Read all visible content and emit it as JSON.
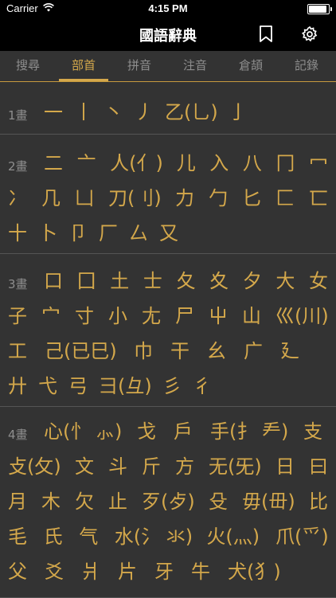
{
  "status_bar": {
    "carrier": "Carrier",
    "time": "4:15 PM"
  },
  "nav": {
    "title": "國語辭典"
  },
  "tabs": [
    {
      "label": "搜尋"
    },
    {
      "label": "部首"
    },
    {
      "label": "拼音"
    },
    {
      "label": "注音"
    },
    {
      "label": "倉頡"
    },
    {
      "label": "記錄"
    }
  ],
  "active_tab": "部首",
  "sections": [
    {
      "label": "1畫",
      "rows": [
        [
          "一",
          "丨",
          "丶",
          "丿",
          "乙(乚)",
          "亅"
        ]
      ]
    },
    {
      "label": "2畫",
      "rows": [
        [
          "二",
          "亠",
          "人(亻)",
          "儿",
          "入",
          "八",
          "冂",
          "冖"
        ],
        [
          "冫",
          "几",
          "凵",
          "刀(刂)",
          "力",
          "勹",
          "匕",
          "匚",
          "匸"
        ],
        [
          "十",
          "卜",
          "卩",
          "厂",
          "厶",
          "又"
        ]
      ]
    },
    {
      "label": "3畫",
      "rows": [
        [
          "口",
          "囗",
          "土",
          "士",
          "夂",
          "夊",
          "夕",
          "大",
          "女"
        ],
        [
          "子",
          "宀",
          "寸",
          "小",
          "尢",
          "尸",
          "屮",
          "山",
          "巛(川)"
        ],
        [
          "工",
          "己(已巳)",
          "巾",
          "干",
          "幺",
          "广",
          "廴"
        ],
        [
          "廾",
          "弋",
          "弓",
          "彐(彑)",
          "彡",
          "彳"
        ]
      ]
    },
    {
      "label": "4畫",
      "rows": [
        [
          "心(忄 ⺗)",
          "戈",
          "戶",
          "手(扌 龵)",
          "支"
        ],
        [
          "攴(攵)",
          "文",
          "斗",
          "斤",
          "方",
          "无(旡)",
          "日",
          "曰"
        ],
        [
          "月",
          "木",
          "欠",
          "止",
          "歹(歺)",
          "殳",
          "毋(毌)",
          "比"
        ],
        [
          "毛",
          "氏",
          "气",
          "水(氵 氺)",
          "火(灬)",
          "爪(爫)"
        ],
        [
          "父",
          "爻",
          "爿",
          "片",
          "牙",
          "牛",
          "犬(犭)"
        ]
      ]
    }
  ]
}
